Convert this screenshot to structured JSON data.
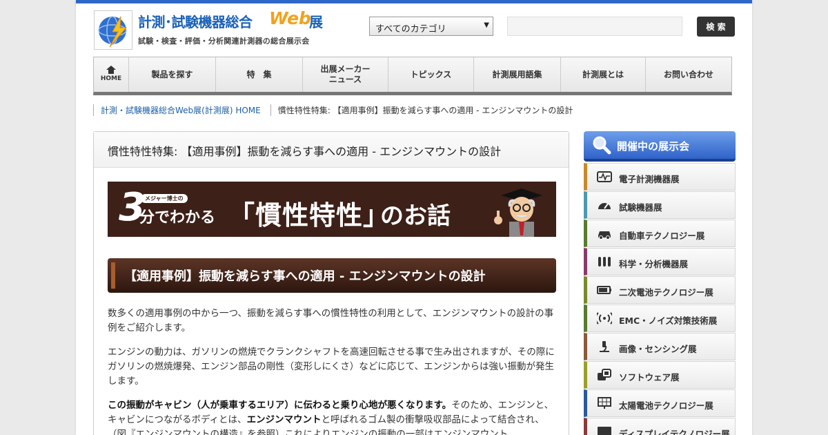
{
  "header": {
    "logo_title": "計測･試験機器総合",
    "logo_web": "Web",
    "logo_ten": "展",
    "logo_subtitle": "試験・検査・評価・分析関連計測器の総合展示会",
    "category_selected": "すべてのカテゴリ",
    "search_value": "",
    "search_button": "検 索"
  },
  "nav": [
    {
      "label": "HOME",
      "icon": "home-icon"
    },
    {
      "label": "製品を探す"
    },
    {
      "label": "特　集"
    },
    {
      "label": "出展メーカー\nニュース"
    },
    {
      "label": "トピックス"
    },
    {
      "label": "計測展用語集"
    },
    {
      "label": "計測展とは"
    },
    {
      "label": "お問い合わせ"
    }
  ],
  "breadcrumb": {
    "home": "計測・試験機器総合Web展(計測展) HOME",
    "current": "慣性特性特集: 【適用事例】振動を減らす事への適用 - エンジンマウントの設計"
  },
  "main": {
    "heading": "慣性特性特集: 【適用事例】振動を減らす事への適用 - エンジンマウントの設計",
    "banner": {
      "number": "3",
      "tag": "メジャー博士の",
      "text": "分でわかる",
      "big": "「慣性特性」",
      "tail": "のお話"
    },
    "section_title": "【適用事例】振動を減らす事への適用 - エンジンマウントの設計",
    "p1": "数多くの適用事例の中から一つ、振動を減らす事への慣性特性の利用として、エンジンマウントの設計の事例をご紹介します。",
    "p2": "エンジンの動力は、ガソリンの燃焼でクランクシャフトを高速回転させる事で生み出されますが、その際にガソリンの燃焼爆発、エンジン部品の剛性（変形しにくさ）などに応じて、エンジンからは強い振動が発生します。",
    "p3_bold1": "この振動がキャビン（人が乗車するエリア）に伝わると乗り心地が悪くなります。",
    "p3_a": "そのため、エンジンと、キャビンにつながるボディとは、",
    "p3_bold2": "エンジンマウント",
    "p3_b": "と呼ばれるゴム製の衝撃吸収部品によって結合され、（図『エンジンマウントの構造』を参照）これによりエンジンの振動の一部はエンジンマウント"
  },
  "sidebar": {
    "title": "開催中の展示会",
    "items": [
      {
        "label": "電子計測機器展",
        "icon": "waveform-icon",
        "color": "#c98a2a"
      },
      {
        "label": "試験機器展",
        "icon": "gauge-icon",
        "color": "#4a9ab0"
      },
      {
        "label": "自動車テクノロジー展",
        "icon": "car-icon",
        "color": "#5b7a2e"
      },
      {
        "label": "科学・分析機器展",
        "icon": "test-tubes-icon",
        "color": "#8a3a6a"
      },
      {
        "label": "二次電池テクノロジー展",
        "icon": "battery-icon",
        "color": "#7a8a2a"
      },
      {
        "label": "EMC・ノイズ対策技術展",
        "icon": "signal-icon",
        "color": "#5b7a2e"
      },
      {
        "label": "画像・センシング展",
        "icon": "microscope-icon",
        "color": "#8a5a3a"
      },
      {
        "label": "ソフトウェア展",
        "icon": "software-icon",
        "color": "#9aa02a"
      },
      {
        "label": "太陽電池テクノロジー展",
        "icon": "solar-panel-icon",
        "color": "#2a5aa0"
      },
      {
        "label": "ディスプレイテクノロジー展",
        "icon": "display-icon",
        "color": "#8a3a3a"
      }
    ]
  }
}
